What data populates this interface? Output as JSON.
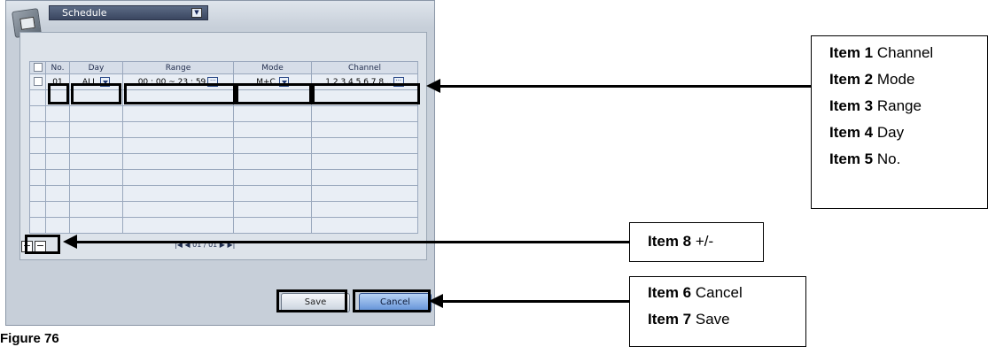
{
  "window": {
    "menu_label": "Schedule"
  },
  "table": {
    "headers": [
      "No.",
      "Day",
      "Range",
      "Mode",
      "Channel"
    ],
    "row": {
      "no": "01",
      "day": "ALL",
      "range": "00 : 00 ~ 23 : 59",
      "mode": "M+C",
      "channel": "1 2 3 4 5 6 7 8..."
    }
  },
  "pagination": {
    "text": "01 / 01"
  },
  "buttons": {
    "add": "+",
    "remove": "−",
    "save": "Save",
    "cancel": "Cancel"
  },
  "figure_caption": "Figure 76",
  "callouts": {
    "group1": [
      {
        "item": "Item 1",
        "label": "Channel"
      },
      {
        "item": "Item 2",
        "label": "Mode"
      },
      {
        "item": "Item 3",
        "label": "Range"
      },
      {
        "item": "Item 4",
        "label": "Day"
      },
      {
        "item": "Item 5",
        "label": "No."
      }
    ],
    "group2": [
      {
        "item": "Item 8",
        "label": "+/-"
      }
    ],
    "group3": [
      {
        "item": "Item 6",
        "label": "Cancel"
      },
      {
        "item": "Item 7",
        "label": "Save"
      }
    ]
  }
}
